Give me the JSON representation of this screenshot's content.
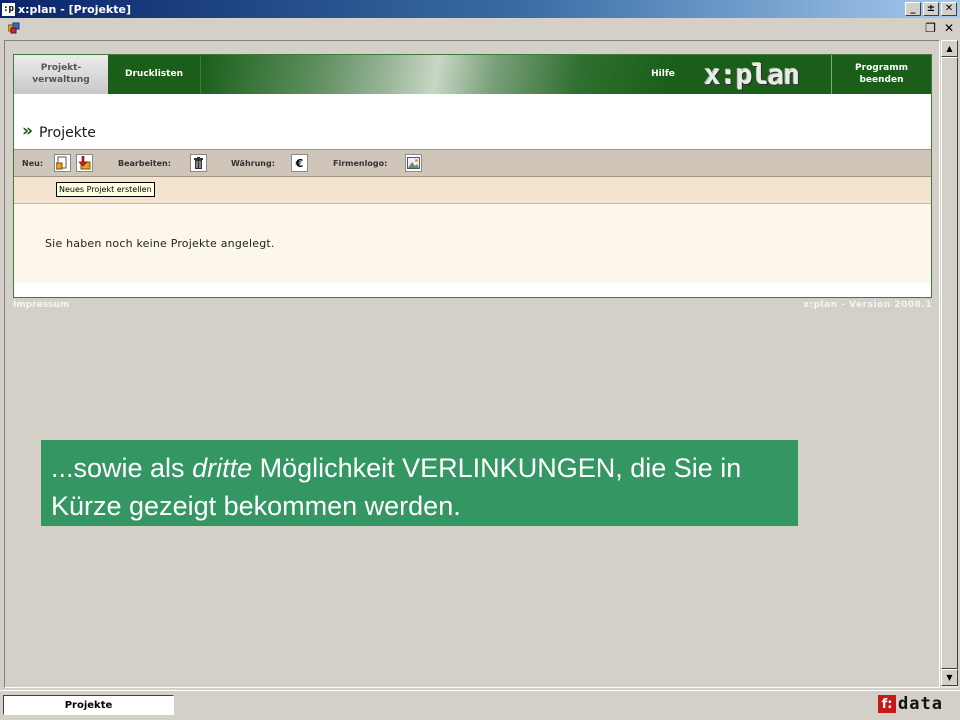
{
  "window": {
    "app_icon": ":p",
    "title": "x:plan - [Projekte]",
    "minimize": "_",
    "maximize": "±",
    "close": "✕"
  },
  "mdi": {
    "restore": "❐",
    "close": "✕"
  },
  "nav": {
    "projekt_line1": "Projekt-",
    "projekt_line2": "verwaltung",
    "drucklisten": "Drucklisten",
    "hilfe": "Hilfe",
    "logo": "x:plan",
    "beenden_line1": "Programm",
    "beenden_line2": "beenden"
  },
  "page": {
    "title_marker": "»",
    "title": "Projekte"
  },
  "toolbar": {
    "neu_label": "Neu:",
    "bearbeiten_label": "Bearbeiten:",
    "waehrung_label": "Währung:",
    "waehrung_symbol": "€",
    "firmenlogo_label": "Firmenlogo:"
  },
  "tooltip": "Neues Projekt erstellen",
  "content": {
    "empty_message": "Sie haben noch keine Projekte angelegt."
  },
  "footer": {
    "left": "Impressum",
    "right": "x:plan - Version 2008.1"
  },
  "callout": {
    "pre": "...sowie als ",
    "emph": "dritte",
    "post": " Möglichkeit VERLINKUNGEN, die Sie in Kürze gezeigt  bekommen werden."
  },
  "statusbar": {
    "tab": "Projekte",
    "brand_mark": "f:",
    "brand_text": "data"
  },
  "colors": {
    "nav_green": "#1a5e1a",
    "callout_green": "#349663",
    "toolbar_beige": "#cfc5b8",
    "content_cream": "#fcf7ea"
  }
}
